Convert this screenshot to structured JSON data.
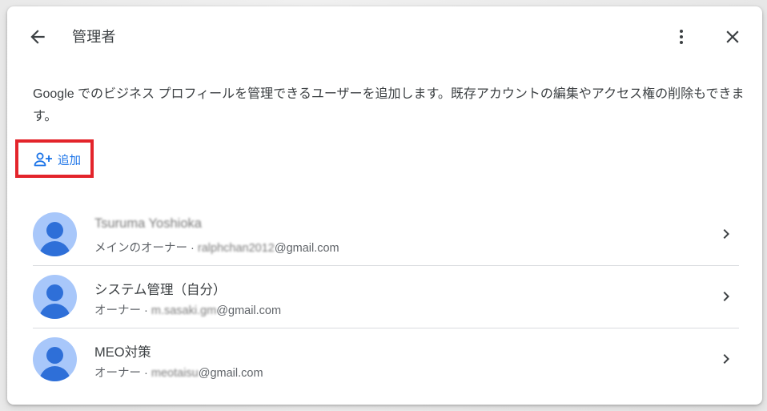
{
  "header": {
    "title": "管理者"
  },
  "description": "Google でのビジネス プロフィールを管理できるユーザーを追加します。既存アカウントの編集やアクセス権の削除もできます。",
  "add_button": {
    "label": "追加"
  },
  "users": [
    {
      "name": "Tsuruma Yoshioka",
      "role": "メインのオーナー ·",
      "email_hidden": "ralphchan2012",
      "email_domain": "@gmail.com"
    },
    {
      "name": "システム管理（自分）",
      "role": "オーナー ·",
      "email_hidden": "m.sasaki.gm",
      "email_domain": "@gmail.com"
    },
    {
      "name": "MEO対策",
      "role": "オーナー ·",
      "email_hidden": "meotaisu",
      "email_domain": "@gmail.com"
    }
  ],
  "colors": {
    "accent": "#1a73e8",
    "avatar_bg": "#a8c7fa",
    "avatar_fg": "#2e6fd8",
    "highlight": "#e3242b"
  }
}
